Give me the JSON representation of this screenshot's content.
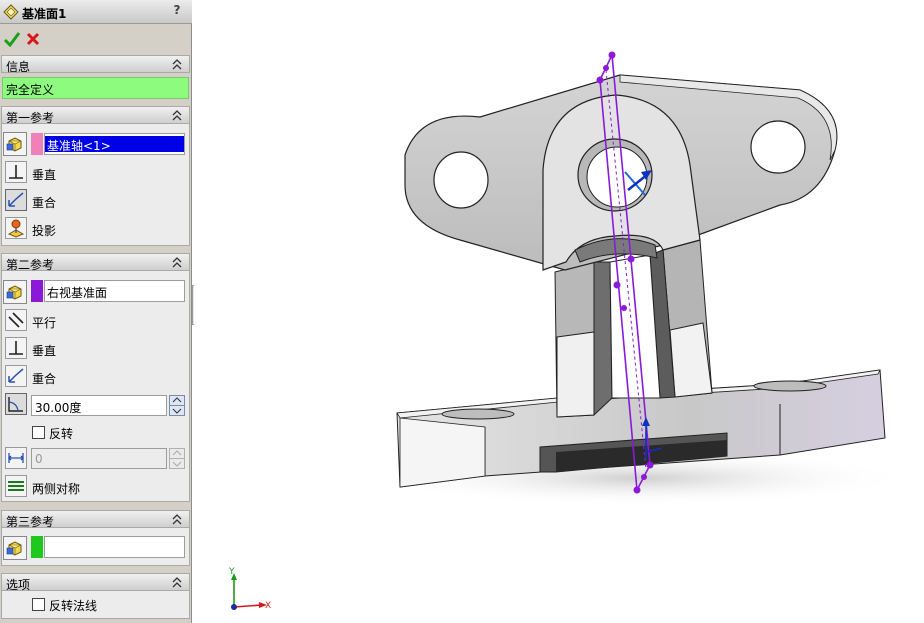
{
  "window": {
    "title": "基准面1",
    "help": "?"
  },
  "actions": {
    "ok_icon": "check-icon",
    "cancel_icon": "x-icon"
  },
  "info": {
    "header": "信息",
    "status": "完全定义",
    "status_color": "#8dfb7e"
  },
  "first_reference": {
    "header": "第一参考",
    "value": "基准轴<1>",
    "chip_color": "#f080b8",
    "options": [
      "垂直",
      "重合",
      "投影"
    ]
  },
  "second_reference": {
    "header": "第二参考",
    "value": "右视基准面",
    "chip_color": "#8a1ad8",
    "options": [
      "平行",
      "垂直",
      "重合"
    ],
    "angle": "30.00度",
    "flip_label": "反转",
    "distance": "0",
    "symmetric_label": "两侧对称"
  },
  "third_reference": {
    "header": "第三参考",
    "value": "",
    "chip_color": "#1ec81e"
  },
  "options": {
    "header": "选项",
    "flip_normal_label": "反转法线"
  },
  "triad": {
    "x": "X",
    "y": "Y"
  },
  "colors": {
    "plane": "#8a1ad8",
    "accent": "#0000e6"
  }
}
